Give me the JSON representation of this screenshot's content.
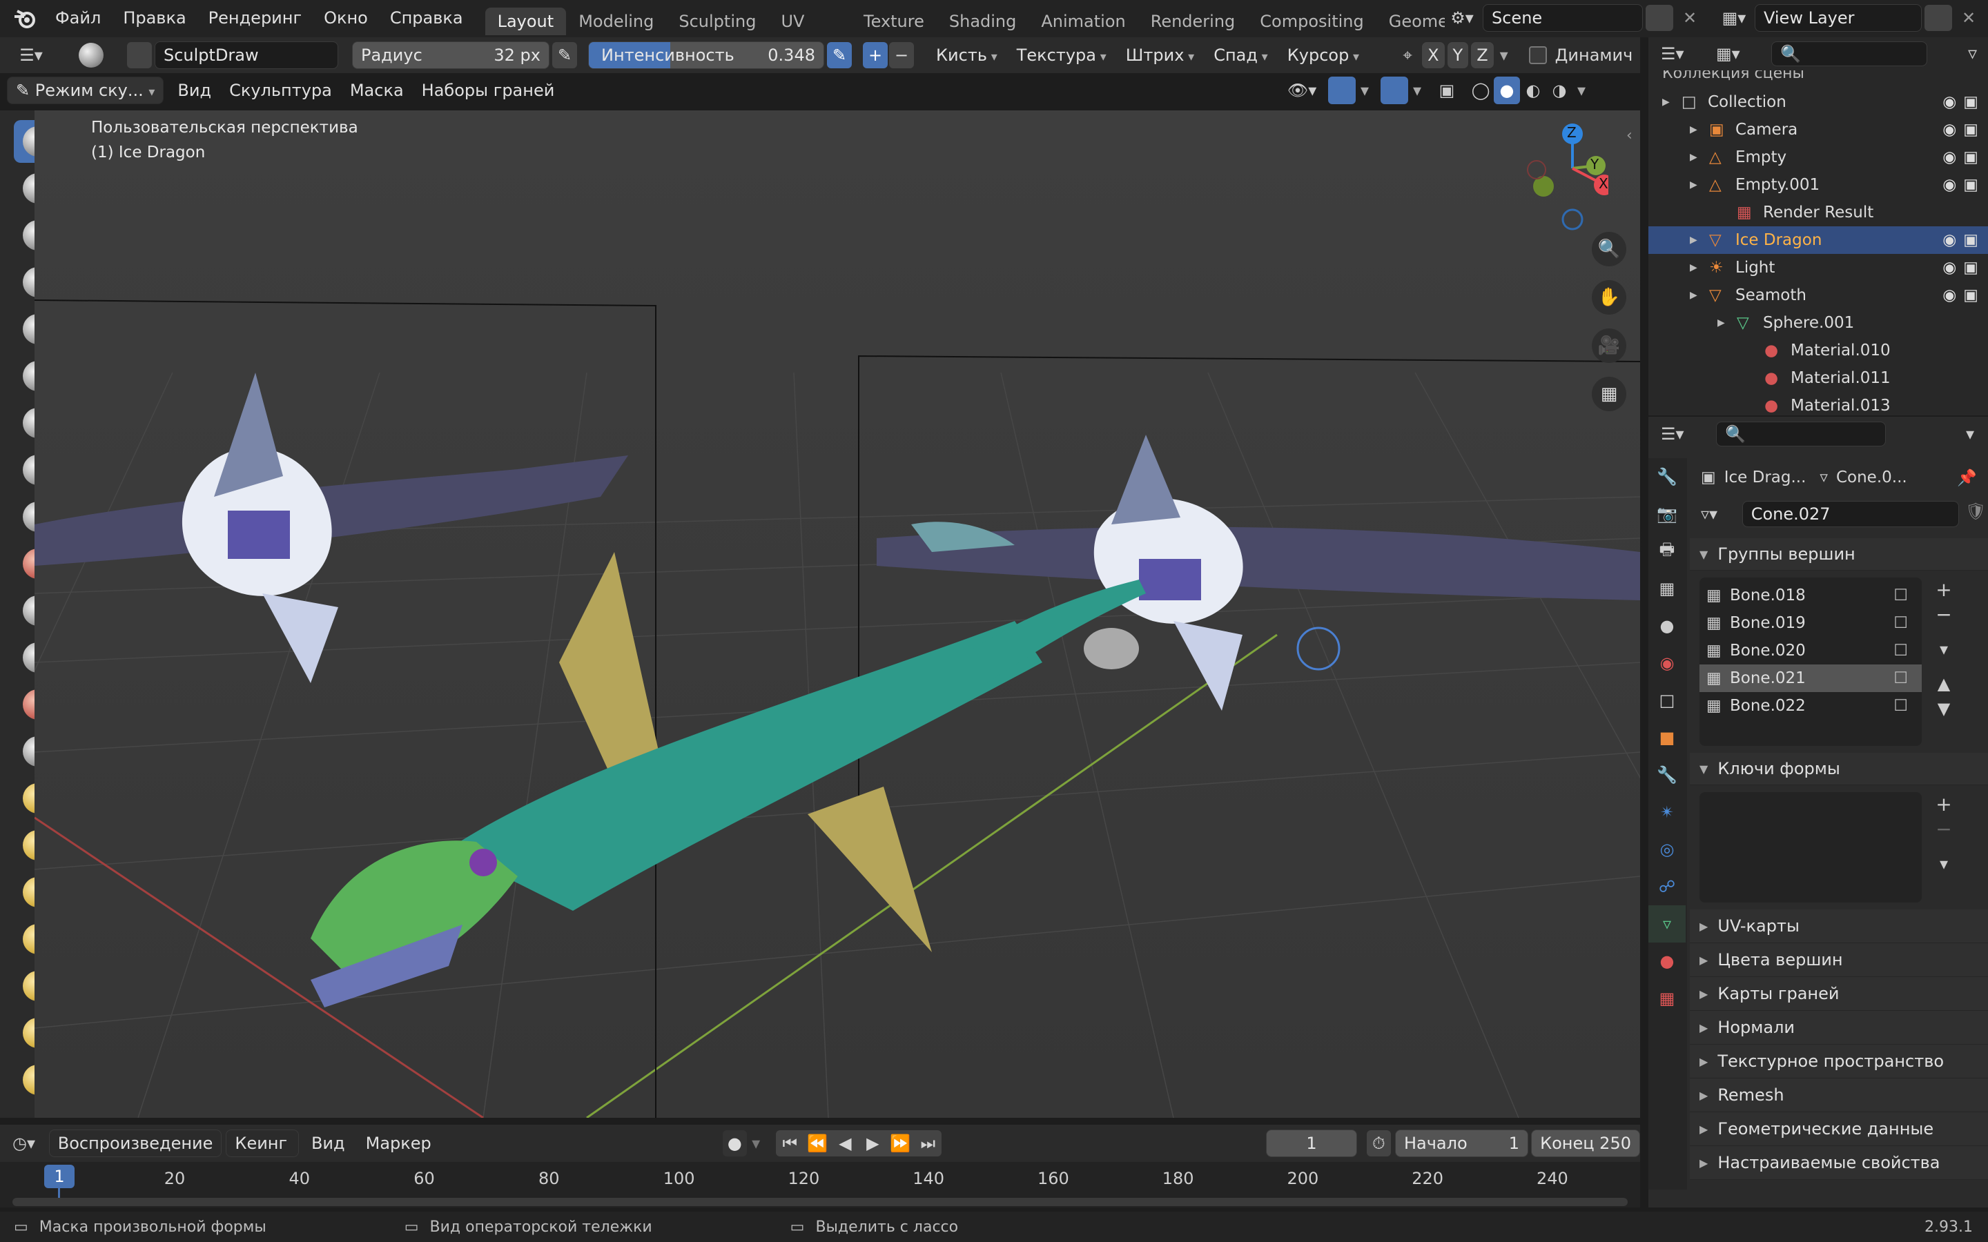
{
  "topbar": {
    "menus": [
      "Файл",
      "Правка",
      "Рендеринг",
      "Окно",
      "Справка"
    ],
    "workspaces": [
      "Layout",
      "Modeling",
      "Sculpting",
      "UV Editing",
      "Texture Paint",
      "Shading",
      "Animation",
      "Rendering",
      "Compositing",
      "Geometry"
    ],
    "scene": "Scene",
    "view_layer": "View Layer"
  },
  "tool_header": {
    "brush_name": "SculptDraw",
    "radius_label": "Радиус",
    "radius_value": "32 px",
    "strength_label": "Интенсивность",
    "strength_value": "0.348",
    "strength_fraction": 0.348,
    "menus": [
      "Кисть",
      "Текстура",
      "Штрих",
      "Спад",
      "Курсор"
    ],
    "axes": [
      "X",
      "Y",
      "Z"
    ],
    "dynamic_label": "Динамич"
  },
  "view_header": {
    "mode": "Режим ску...",
    "menus": [
      "Вид",
      "Скульптура",
      "Маска",
      "Наборы граней"
    ]
  },
  "viewport": {
    "perspective": "Пользовательская перспектива",
    "active_object": "(1) Ice Dragon",
    "gizmo_axes": [
      "Z",
      "Y",
      "X"
    ]
  },
  "outliner": {
    "collection_header": "Коллекция сцены",
    "items": [
      {
        "label": "Collection",
        "indent": 0,
        "icon": "collection-icon"
      },
      {
        "label": "Camera",
        "indent": 1,
        "icon": "camera-icon"
      },
      {
        "label": "Empty",
        "indent": 1,
        "icon": "empty-icon"
      },
      {
        "label": "Empty.001",
        "indent": 1,
        "icon": "empty-icon"
      },
      {
        "label": "Render Result",
        "indent": 2,
        "icon": "image-icon"
      },
      {
        "label": "Ice Dragon",
        "indent": 1,
        "icon": "mesh-icon",
        "selected": true
      },
      {
        "label": "Light",
        "indent": 1,
        "icon": "light-icon"
      },
      {
        "label": "Seamoth",
        "indent": 1,
        "icon": "mesh-icon"
      },
      {
        "label": "Sphere.001",
        "indent": 2,
        "icon": "mesh-data-icon"
      },
      {
        "label": "Material.010",
        "indent": 3,
        "icon": "material-icon"
      },
      {
        "label": "Material.011",
        "indent": 3,
        "icon": "material-icon"
      },
      {
        "label": "Material.013",
        "indent": 3,
        "icon": "material-icon"
      }
    ]
  },
  "properties": {
    "breadcrumb_object": "Ice Drag...",
    "breadcrumb_data": "Cone.0...",
    "mesh_name": "Cone.027",
    "vertex_groups_title": "Группы вершин",
    "vertex_groups": [
      "Bone.018",
      "Bone.019",
      "Bone.020",
      "Bone.021",
      "Bone.022"
    ],
    "vertex_group_selected": "Bone.021",
    "shape_keys_title": "Ключи формы",
    "collapsed_panels": [
      "UV-карты",
      "Цвета вершин",
      "Карты граней",
      "Нормали",
      "Текстурное пространство",
      "Remesh",
      "Геометрические данные",
      "Настраиваемые свойства"
    ]
  },
  "timeline": {
    "menus": [
      "Воспроизведение",
      "Кеинг",
      "Вид",
      "Маркер"
    ],
    "current_frame": "1",
    "start_label": "Начало",
    "start_value": "1",
    "end_label": "Конец",
    "end_value": "250",
    "ticks": [
      "1",
      "20",
      "40",
      "60",
      "80",
      "100",
      "120",
      "140",
      "160",
      "180",
      "200",
      "220",
      "240"
    ]
  },
  "statusbar": {
    "left": "Маска произвольной формы",
    "middle": "Вид операторской тележки",
    "right_action": "Выделить с лассо",
    "version": "2.93.1"
  },
  "colors": {
    "accent": "#4772b3",
    "selection": "#334d80",
    "x_axis": "#e84a52",
    "y_axis": "#8bc34a",
    "z_axis": "#2f86e0"
  }
}
